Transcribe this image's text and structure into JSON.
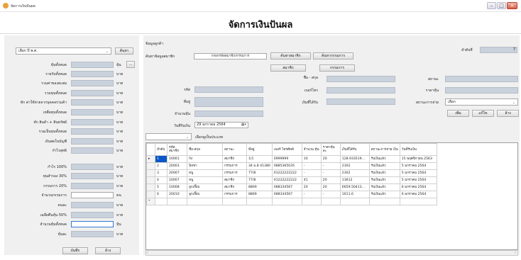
{
  "window": {
    "title": "จัดการเงินปันผล"
  },
  "page": {
    "heading": "จัดการเงินปันผล"
  },
  "left": {
    "year_select": "เลือก ปี พ.ศ.",
    "search_button": "ค้นหา",
    "fields": [
      {
        "label": "หุ้นทั้งหมด",
        "unit": "หุ้น"
      },
      {
        "label": "รายรับทั้งหมด",
        "unit": "บาท"
      },
      {
        "label": "รวมค่าของสะสม",
        "unit": "บาท"
      },
      {
        "label": "รวมทุนทั้งหมด",
        "unit": "บาท"
      },
      {
        "label": "หัก ค่าใช้จ่ายจากบุคคลร่วมค้า",
        "unit": "บาท"
      },
      {
        "label": "เหลือทุนทั้งหมด",
        "unit": "บาท"
      },
      {
        "label": "หัก สินค้า + สินทรัพย์",
        "unit": "บาท"
      },
      {
        "label": "รวมเป็นทุนทั้งหมด",
        "unit": "บาท"
      },
      {
        "label": "เงินสดในบัญชี",
        "unit": "บาท"
      },
      {
        "label": "กำไรสุทธิ",
        "unit": "บาท"
      },
      {
        "label": "กำไร 100%",
        "unit": "บาท"
      },
      {
        "label": "ทุนสำรอง 30%",
        "unit": "บาท"
      },
      {
        "label": "กรรมการ 20%",
        "unit": "บาท"
      },
      {
        "label": "จำนวนกรรมการ",
        "unit": "คน"
      },
      {
        "label": "คนละ",
        "unit": "บาท"
      },
      {
        "label": "เฉลี่ยคืนหุ้น 50%",
        "unit": "บาท"
      },
      {
        "label": "จำนวนหุ้นทั้งหมด",
        "unit": "หุ้น"
      },
      {
        "label": "หุ้นละ",
        "unit": "บาท"
      }
    ],
    "dots_button": "...",
    "save_button": "บันทึก",
    "clear_button": "ล้าง"
  },
  "member": {
    "section_title": "ข้อมูลลูกค้า",
    "search_label": "ค้นหาข้อมูลสมาชิก",
    "search_placeholder": "กรอกรหัสสมาชิก/กรรมการ",
    "btn_search_member": "ค้นหาสมาชิก",
    "btn_search_committee": "ค้นหากรรมการ",
    "tab_member": "สมาชิก",
    "tab_committee": "กรรมการ",
    "order_label": "ลำดับที่",
    "order_value": "7",
    "code_label": "รหัส",
    "name_label": "ชื่อ - สกุล",
    "status_label": "สถานะ",
    "address_label": "ที่อยู่",
    "phone_label": "เบอร์โทร",
    "shares_label": "จำนวนหุ้น",
    "share_price_label": "ราคาหุ้น",
    "dividend_label": "เงินที่ได้รับ",
    "pay_status_label": "สถานะการจ่าย",
    "pay_status_value": "เลือก",
    "date_label": "วันที่รับเงิน",
    "date_value": "29  มกราคม   2564",
    "btn_add": "เพิ่ม",
    "btn_edit": "แก้ไข",
    "btn_clear": "ล้าง"
  },
  "filter": {
    "label": "เลือกดูเป็นประเภท"
  },
  "table": {
    "columns": [
      "ลำดับ",
      "รหัส สมาชิก",
      "ชื่อ-สกุล",
      "สถานะ",
      "ที่อยู่",
      "เบอร์ โทรศัพท์",
      "จำนวน หุ้น",
      "ราคาหุ้น ละ",
      "เงินที่ได้รับ",
      "สถานะการจ่าย เงิน",
      "วันที่รับเงิน"
    ],
    "rows": [
      [
        "1",
        "10001",
        "ก้ง",
        "สมาชิก",
        "1/1",
        "0999999",
        "10",
        "20",
        "128.933519...",
        "รับเงินแล้ว",
        "15 พฤศจิกายน 2563"
      ],
      [
        "2",
        "20003",
        "นิจชา",
        "กรรมการ",
        "34 ม.8 41380",
        "0885365035",
        "-",
        "-",
        "2302",
        "รับเงินแล้ว",
        "5 มกราคม 2564"
      ],
      [
        "3",
        "20007",
        "หนู",
        "กรรมการ",
        "77/8",
        "01222222222",
        "-",
        "-",
        "2302",
        "รับเงินแล้ว",
        "5 มกราคม 2564"
      ],
      [
        "4",
        "10007",
        "หนู",
        "สมาชิก",
        "77/8",
        "01222222222",
        "41",
        "20",
        "13612",
        "รับเงินแล้ว",
        "5 มกราคม 2564"
      ],
      [
        "5",
        "10008",
        "ลูกเจี๊ยบ",
        "สมาชิก",
        "8869",
        "088334567",
        "20",
        "20",
        "6659.50413...",
        "รับเงินแล้ว",
        "6 มกราคม 2564"
      ],
      [
        "6",
        "20010",
        "ลูกเจี๊ยบ",
        "กรรมการ",
        "8869",
        "088334567",
        "-",
        "-",
        "1611.6",
        "รับเงินแล้ว",
        "6 มกราคม 2564"
      ]
    ]
  },
  "icons": {
    "app": "app-icon",
    "calendar": "calendar-icon",
    "dropdown": "chevron-down-icon"
  }
}
